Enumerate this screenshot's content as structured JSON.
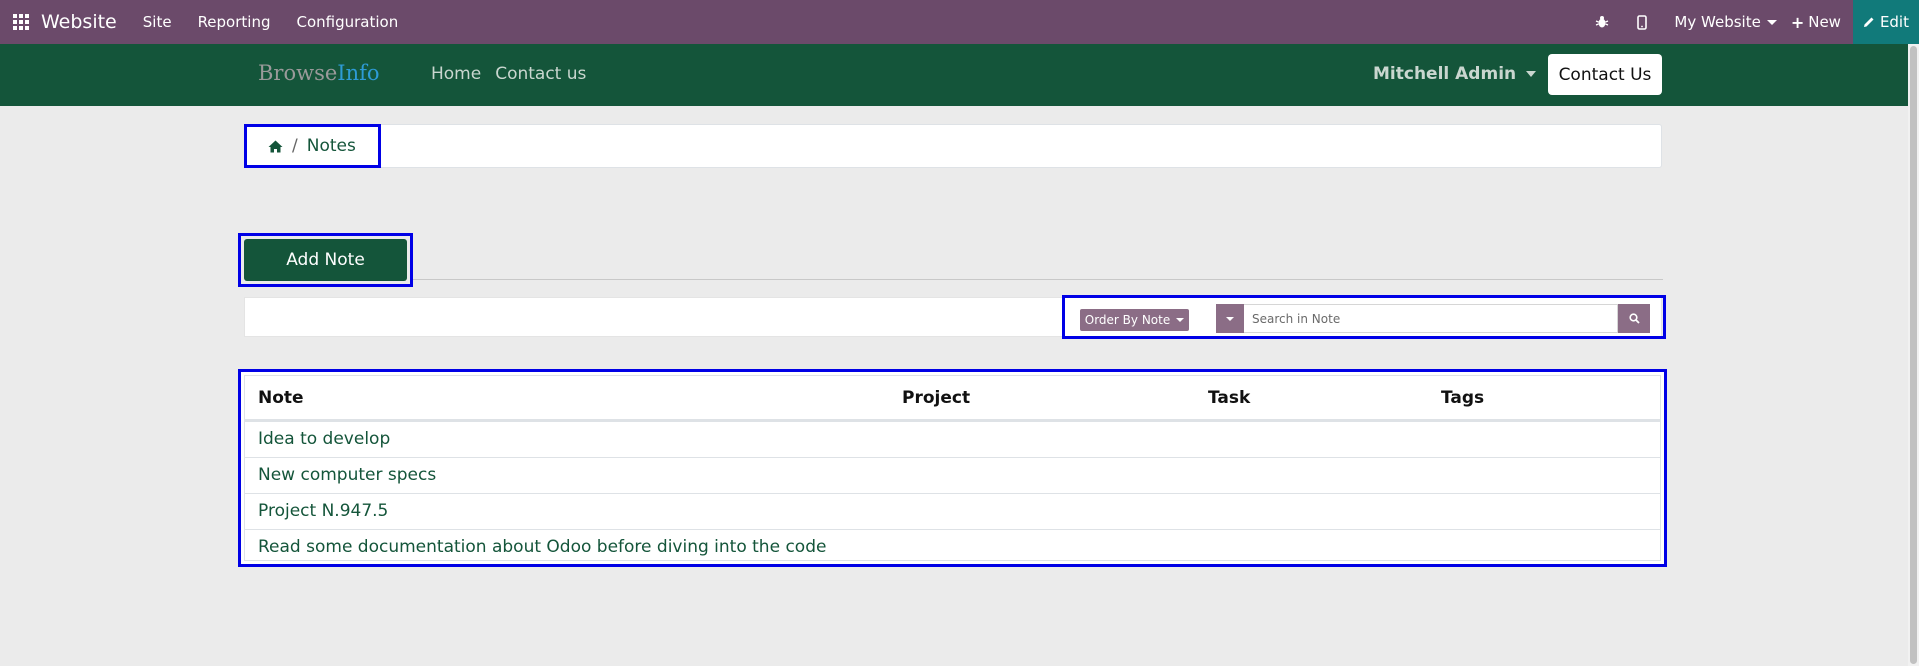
{
  "topbar": {
    "app_title": "Website",
    "menu": [
      "Site",
      "Reporting",
      "Configuration"
    ],
    "website_selector": "My Website",
    "new_label": "New",
    "edit_label": "Edit"
  },
  "site_header": {
    "logo_part1": "Browse",
    "logo_part2": "Info",
    "nav": [
      "Home",
      "Contact us"
    ],
    "user_name": "Mitchell Admin",
    "contact_button": "Contact Us"
  },
  "breadcrumb": {
    "current": "Notes"
  },
  "actions": {
    "add_note": "Add Note"
  },
  "toolbar": {
    "order_by": "Order By Note",
    "search_placeholder": "Search in Note"
  },
  "table": {
    "columns": [
      "Note",
      "Project",
      "Task",
      "Tags"
    ],
    "rows": [
      {
        "note": "Idea to develop",
        "project": "",
        "task": "",
        "tags": ""
      },
      {
        "note": "New computer specs",
        "project": "",
        "task": "",
        "tags": ""
      },
      {
        "note": "Project N.947.5",
        "project": "",
        "task": "",
        "tags": ""
      },
      {
        "note": "Read some documentation about Odoo before diving into the code",
        "project": "",
        "task": "",
        "tags": ""
      }
    ]
  },
  "colors": {
    "odoo_bar": "#6b4a6a",
    "site_header": "#14553a",
    "edit_button": "#117a7a",
    "accent_buttons": "#8b6d86",
    "highlight_border": "#0000e6"
  }
}
